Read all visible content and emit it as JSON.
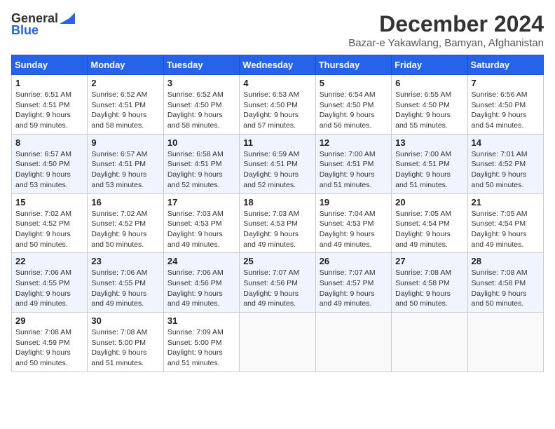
{
  "logo": {
    "general": "General",
    "blue": "Blue"
  },
  "title": "December 2024",
  "location": "Bazar-e Yakawlang, Bamyan, Afghanistan",
  "days_header": [
    "Sunday",
    "Monday",
    "Tuesday",
    "Wednesday",
    "Thursday",
    "Friday",
    "Saturday"
  ],
  "weeks": [
    [
      {
        "day": "1",
        "sunrise": "6:51 AM",
        "sunset": "4:51 PM",
        "daylight": "9 hours and 59 minutes."
      },
      {
        "day": "2",
        "sunrise": "6:52 AM",
        "sunset": "4:51 PM",
        "daylight": "9 hours and 58 minutes."
      },
      {
        "day": "3",
        "sunrise": "6:52 AM",
        "sunset": "4:50 PM",
        "daylight": "9 hours and 58 minutes."
      },
      {
        "day": "4",
        "sunrise": "6:53 AM",
        "sunset": "4:50 PM",
        "daylight": "9 hours and 57 minutes."
      },
      {
        "day": "5",
        "sunrise": "6:54 AM",
        "sunset": "4:50 PM",
        "daylight": "9 hours and 56 minutes."
      },
      {
        "day": "6",
        "sunrise": "6:55 AM",
        "sunset": "4:50 PM",
        "daylight": "9 hours and 55 minutes."
      },
      {
        "day": "7",
        "sunrise": "6:56 AM",
        "sunset": "4:50 PM",
        "daylight": "9 hours and 54 minutes."
      }
    ],
    [
      {
        "day": "8",
        "sunrise": "6:57 AM",
        "sunset": "4:50 PM",
        "daylight": "9 hours and 53 minutes."
      },
      {
        "day": "9",
        "sunrise": "6:57 AM",
        "sunset": "4:51 PM",
        "daylight": "9 hours and 53 minutes."
      },
      {
        "day": "10",
        "sunrise": "6:58 AM",
        "sunset": "4:51 PM",
        "daylight": "9 hours and 52 minutes."
      },
      {
        "day": "11",
        "sunrise": "6:59 AM",
        "sunset": "4:51 PM",
        "daylight": "9 hours and 52 minutes."
      },
      {
        "day": "12",
        "sunrise": "7:00 AM",
        "sunset": "4:51 PM",
        "daylight": "9 hours and 51 minutes."
      },
      {
        "day": "13",
        "sunrise": "7:00 AM",
        "sunset": "4:51 PM",
        "daylight": "9 hours and 51 minutes."
      },
      {
        "day": "14",
        "sunrise": "7:01 AM",
        "sunset": "4:52 PM",
        "daylight": "9 hours and 50 minutes."
      }
    ],
    [
      {
        "day": "15",
        "sunrise": "7:02 AM",
        "sunset": "4:52 PM",
        "daylight": "9 hours and 50 minutes."
      },
      {
        "day": "16",
        "sunrise": "7:02 AM",
        "sunset": "4:52 PM",
        "daylight": "9 hours and 50 minutes."
      },
      {
        "day": "17",
        "sunrise": "7:03 AM",
        "sunset": "4:53 PM",
        "daylight": "9 hours and 49 minutes."
      },
      {
        "day": "18",
        "sunrise": "7:03 AM",
        "sunset": "4:53 PM",
        "daylight": "9 hours and 49 minutes."
      },
      {
        "day": "19",
        "sunrise": "7:04 AM",
        "sunset": "4:53 PM",
        "daylight": "9 hours and 49 minutes."
      },
      {
        "day": "20",
        "sunrise": "7:05 AM",
        "sunset": "4:54 PM",
        "daylight": "9 hours and 49 minutes."
      },
      {
        "day": "21",
        "sunrise": "7:05 AM",
        "sunset": "4:54 PM",
        "daylight": "9 hours and 49 minutes."
      }
    ],
    [
      {
        "day": "22",
        "sunrise": "7:06 AM",
        "sunset": "4:55 PM",
        "daylight": "9 hours and 49 minutes."
      },
      {
        "day": "23",
        "sunrise": "7:06 AM",
        "sunset": "4:55 PM",
        "daylight": "9 hours and 49 minutes."
      },
      {
        "day": "24",
        "sunrise": "7:06 AM",
        "sunset": "4:56 PM",
        "daylight": "9 hours and 49 minutes."
      },
      {
        "day": "25",
        "sunrise": "7:07 AM",
        "sunset": "4:56 PM",
        "daylight": "9 hours and 49 minutes."
      },
      {
        "day": "26",
        "sunrise": "7:07 AM",
        "sunset": "4:57 PM",
        "daylight": "9 hours and 49 minutes."
      },
      {
        "day": "27",
        "sunrise": "7:08 AM",
        "sunset": "4:58 PM",
        "daylight": "9 hours and 50 minutes."
      },
      {
        "day": "28",
        "sunrise": "7:08 AM",
        "sunset": "4:58 PM",
        "daylight": "9 hours and 50 minutes."
      }
    ],
    [
      {
        "day": "29",
        "sunrise": "7:08 AM",
        "sunset": "4:59 PM",
        "daylight": "9 hours and 50 minutes."
      },
      {
        "day": "30",
        "sunrise": "7:08 AM",
        "sunset": "5:00 PM",
        "daylight": "9 hours and 51 minutes."
      },
      {
        "day": "31",
        "sunrise": "7:09 AM",
        "sunset": "5:00 PM",
        "daylight": "9 hours and 51 minutes."
      },
      null,
      null,
      null,
      null
    ]
  ]
}
